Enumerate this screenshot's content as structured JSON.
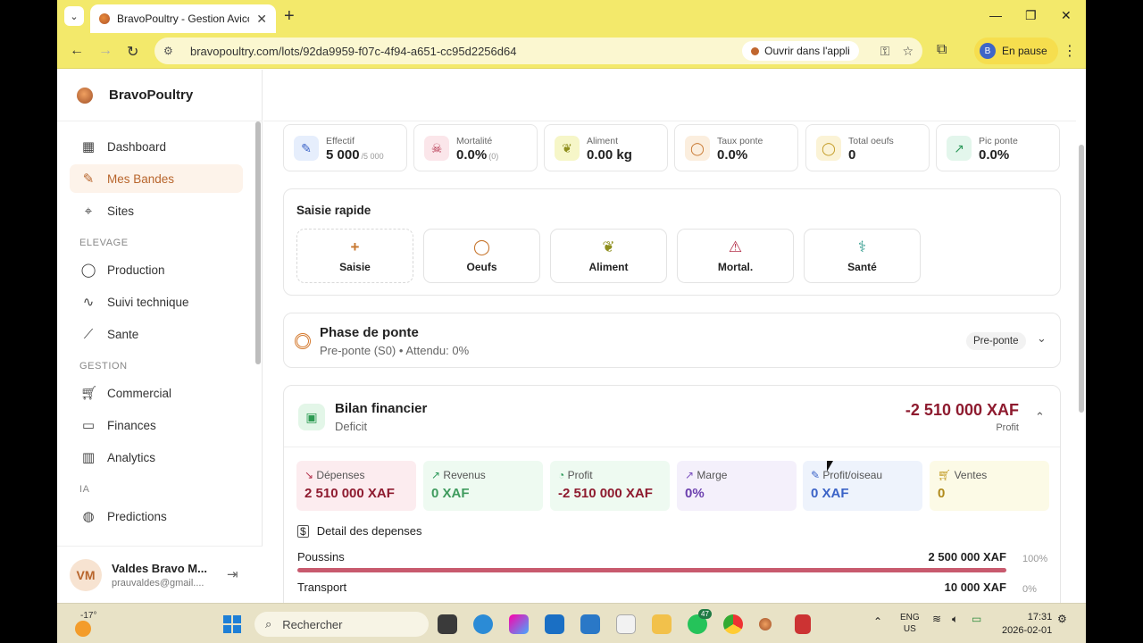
{
  "browser": {
    "tab_title": "BravoPoultry - Gestion Avicole I",
    "url": "bravopoultry.com/lots/92da9959-f07c-4f94-a651-cc95d2256d64",
    "open_app": "Ouvrir dans l'appli",
    "profile_initial": "B",
    "profile_status": "En pause"
  },
  "app": {
    "name": "BravoPoultry"
  },
  "sidebar": {
    "items": [
      {
        "label": "Dashboard"
      },
      {
        "label": "Mes Bandes"
      },
      {
        "label": "Sites"
      }
    ],
    "section_elevage": "ELEVAGE",
    "elevage": [
      {
        "label": "Production"
      },
      {
        "label": "Suivi technique"
      },
      {
        "label": "Sante"
      }
    ],
    "section_gestion": "GESTION",
    "gestion": [
      {
        "label": "Commercial"
      },
      {
        "label": "Finances"
      },
      {
        "label": "Analytics"
      }
    ],
    "section_ia": "IA",
    "ia": [
      {
        "label": "Predictions"
      }
    ],
    "user": {
      "initials": "VM",
      "name": "Valdes Bravo M...",
      "email": "prauvaldes@gmail...."
    }
  },
  "stats": [
    {
      "label": "Effectif",
      "value": "5 000",
      "sub": "/5 000"
    },
    {
      "label": "Mortalité",
      "value": "0.0%",
      "sub": "(0)"
    },
    {
      "label": "Aliment",
      "value": "0.00 kg",
      "sub": ""
    },
    {
      "label": "Taux ponte",
      "value": "0.0%",
      "sub": ""
    },
    {
      "label": "Total oeufs",
      "value": "0",
      "sub": ""
    },
    {
      "label": "Pic ponte",
      "value": "0.0%",
      "sub": ""
    }
  ],
  "quick": {
    "title": "Saisie rapide",
    "buttons": [
      {
        "label": "Saisie"
      },
      {
        "label": "Oeufs"
      },
      {
        "label": "Aliment"
      },
      {
        "label": "Mortal."
      },
      {
        "label": "Santé"
      }
    ]
  },
  "phase": {
    "title": "Phase de ponte",
    "subtitle": "Pre-ponte (S0) • Attendu: 0%",
    "badge": "Pre-ponte"
  },
  "finance": {
    "title": "Bilan financier",
    "subtitle": "Deficit",
    "value": "-2 510 000 XAF",
    "value_label": "Profit",
    "metrics": [
      {
        "label": "Dépenses",
        "value": "2 510 000 XAF"
      },
      {
        "label": "Revenus",
        "value": "0 XAF"
      },
      {
        "label": "Profit",
        "value": "-2 510 000 XAF"
      },
      {
        "label": "Marge",
        "value": "0%"
      },
      {
        "label": "Profit/oiseau",
        "value": "0 XAF"
      },
      {
        "label": "Ventes",
        "value": "0"
      }
    ],
    "detail_title": "Detail des depenses",
    "expenses": [
      {
        "name": "Poussins",
        "amount": "2 500 000 XAF",
        "pct": "100%",
        "fraction": 1.0
      },
      {
        "name": "Transport",
        "amount": "10 000 XAF",
        "pct": "0%",
        "fraction": 0.0
      }
    ]
  },
  "taskbar": {
    "temp": "-17°",
    "search": "Rechercher",
    "whatsapp_badge": "47",
    "lang1": "ENG",
    "lang2": "US",
    "time": "17:31",
    "date": "2026-02-01"
  }
}
